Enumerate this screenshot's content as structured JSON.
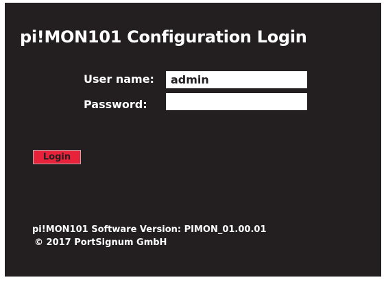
{
  "page": {
    "title": "pi!MON101 Configuration Login"
  },
  "form": {
    "username_label": "User name:",
    "username_value": "admin",
    "password_label": "Password:",
    "password_value": "",
    "login_label": "Login"
  },
  "footer": {
    "version": "pi!MON101 Software Version: PIMON_01.00.01",
    "copyright": "© 2017 PortSignum GmbH"
  },
  "colors": {
    "background": "#231f20",
    "text": "#ffffff",
    "login_button": "#e8223a",
    "input_background": "#ffffff"
  }
}
